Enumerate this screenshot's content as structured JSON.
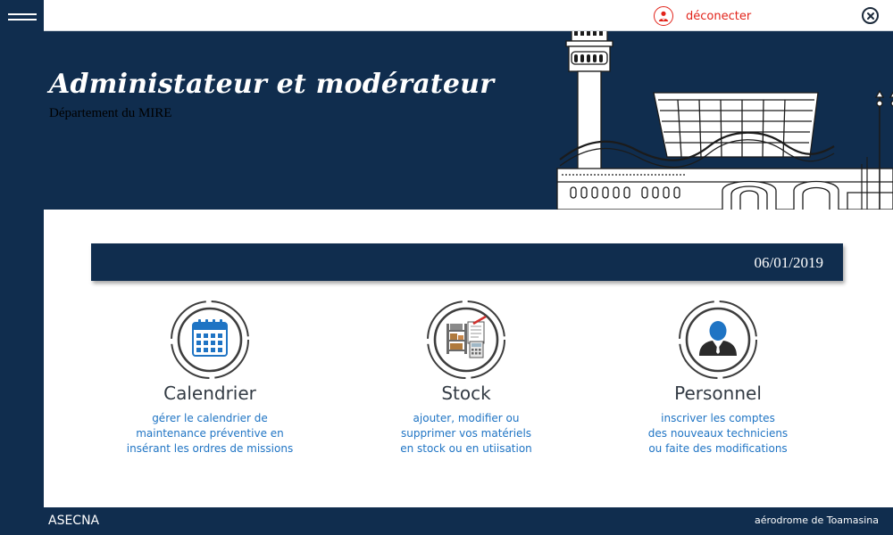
{
  "topbar": {
    "logout_label": "déconecter",
    "logout_icon": "user-logout-icon",
    "close_icon": "close-icon"
  },
  "banner": {
    "title": "Administateur et modérateur",
    "subtitle": "Département du MIRE"
  },
  "date": "06/01/2019",
  "cards": [
    {
      "title": "Calendrier",
      "icon": "calendar-icon",
      "desc": [
        "gérer le calendrier de",
        "maintenance préventive en",
        "insérant les ordres de missions"
      ]
    },
    {
      "title": "Stock",
      "icon": "stock-icon",
      "desc": [
        "ajouter, modifier ou",
        "supprimer vos matériels",
        "en stock ou en utiisation"
      ]
    },
    {
      "title": "Personnel",
      "icon": "person-icon",
      "desc": [
        "inscriver les comptes",
        "des nouveaux techniciens",
        "ou faite des modifications"
      ]
    }
  ],
  "footer": {
    "left": "ASECNA",
    "right": "aérodrome de Toamasina"
  },
  "colors": {
    "navy": "#102d4e",
    "accent_blue": "#1f74c4",
    "logout_red": "#e2231a"
  }
}
